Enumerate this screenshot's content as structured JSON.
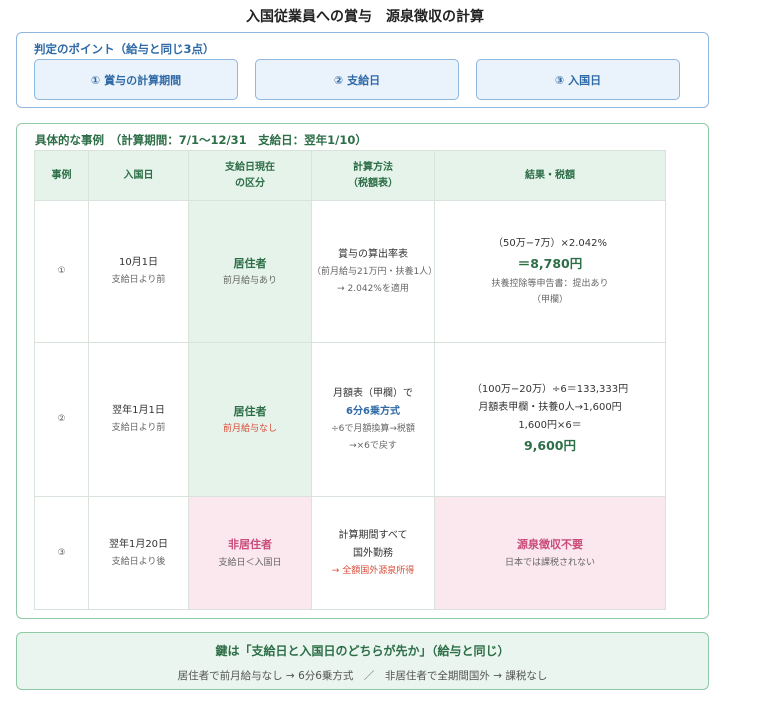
{
  "title": "入国従業員への賞与　源泉徴収の計算",
  "points": {
    "heading": "判定のポイント（給与と同じ3点）",
    "items": [
      "① 賞与の計算期間",
      "② 支給日",
      "③ 入国日"
    ]
  },
  "cases": {
    "heading": "具体的な事例　（計算期間：7/1〜12/31　支給日：翌年1/10）",
    "headers": {
      "case": "事例",
      "entry": "入国日",
      "status_line1": "支給日現在",
      "status_line2": "の区分",
      "method_line1": "計算方法",
      "method_line2": "（税額表）",
      "result": "結果・税額"
    },
    "rows": [
      {
        "num": "①",
        "date": "10月1日",
        "date_note": "支給日より前",
        "status": "居住者",
        "status_note": "前月給与あり",
        "method_main": "賞与の算出率表",
        "method_sub1": "（前月給与21万円・扶養1人）",
        "method_sub2": "→ 2.042%を適用",
        "result_formula": "（50万−7万）×2.042%",
        "result_value": "＝8,780円",
        "result_note1": "扶養控除等申告書：提出あり",
        "result_note2": "（甲欄）"
      },
      {
        "num": "②",
        "date": "翌年1月1日",
        "date_note": "支給日より前",
        "status": "居住者",
        "status_note": "前月給与なし",
        "method_main": "月額表（甲欄）で",
        "method_emph": "6分6乗方式",
        "method_sub1": "÷6で月額換算→税額",
        "method_sub2": "→×6で戻す",
        "result_line1": "（100万−20万）÷6＝133,333円",
        "result_line2": "月額表甲欄・扶養0人→1,600円",
        "result_line3": "1,600円×6＝",
        "result_value": "9,600円"
      },
      {
        "num": "③",
        "date": "翌年1月20日",
        "date_note": "支給日より後",
        "status": "非居住者",
        "status_note": "支給日＜入国日",
        "method_main": "計算期間すべて",
        "method_main2": "国外勤務",
        "method_note": "→ 全額国外源泉所得",
        "result_value": "源泉徴収不要",
        "result_note": "日本では課税されない"
      }
    ]
  },
  "key": {
    "title": "鍵は「支給日と入国日のどちらが先か」（給与と同じ）",
    "sub": "居住者で前月給与なし → 6分6乗方式　／　非居住者で全期間国外 → 課税なし"
  },
  "colors": {
    "blue": "#2f6aa6",
    "green": "#2d6e47",
    "pink": "#c94c7a",
    "red": "#d94d3a"
  }
}
